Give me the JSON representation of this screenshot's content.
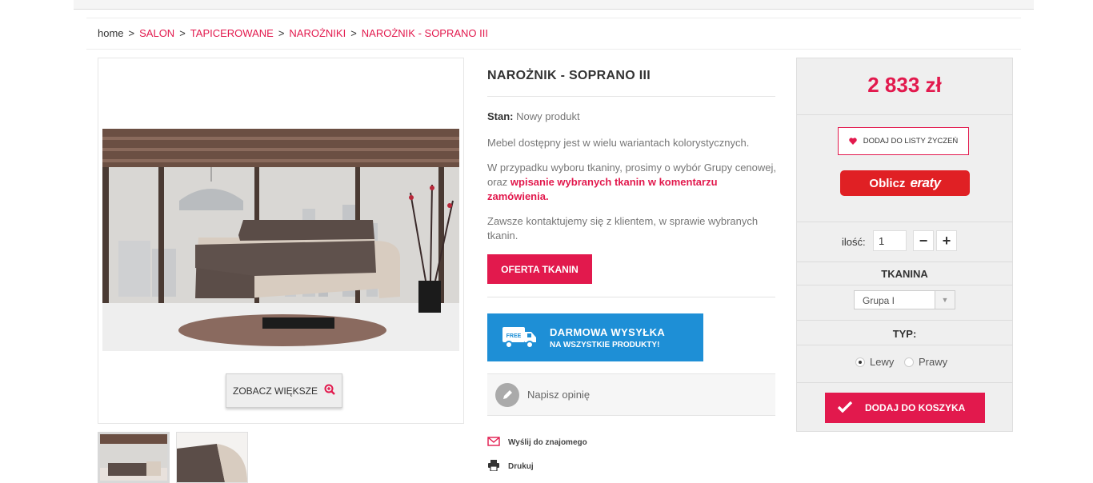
{
  "breadcrumb": {
    "home": "home",
    "separator": ">",
    "items": [
      "SALON",
      "TAPICEROWANE",
      "NAROŻNIKI",
      "NAROŻNIK - SOPRANO III"
    ]
  },
  "gallery": {
    "zoom_label": "ZOBACZ WIĘKSZE",
    "zoom_icon": "zoom-in-icon"
  },
  "product": {
    "title": "NAROŻNIK - SOPRANO III",
    "condition_label": "Stan:",
    "condition_value": "Nowy produkt",
    "desc1": "Mebel dostępny jest w wielu wariantach kolorystycznych.",
    "desc2_pre": "W przypadku wyboru tkaniny, prosimy o wybór Grupy cenowej, oraz ",
    "desc2_bold": "wpisanie wybranych tkanin w komentarzu zamówienia.",
    "desc3": "Zawsze kontaktujemy się z klientem, w sprawie wybranych tkanin.",
    "offer_button": "OFERTA TKANIN",
    "shipping_title": "DARMOWA WYSYŁKA",
    "shipping_sub": "NA WSZYSTKIE PRODUKTY!",
    "shipping_badge": "FREE",
    "review_label": "Napisz opinię",
    "send_friend": "Wyślij do znajomego",
    "print": "Drukuj"
  },
  "buy": {
    "price": "2 833 zł",
    "wishlist": "DODAJ DO LISTY ŻYCZEŃ",
    "eraty_prefix": "Oblicz",
    "eraty_brand": "eraty",
    "qty_label": "ilość:",
    "qty_value": "1",
    "minus": "−",
    "plus": "+",
    "fabric_title": "TKANINA",
    "fabric_selected": "Grupa I",
    "type_title": "TYP:",
    "type_options": [
      "Lewy",
      "Prawy"
    ],
    "type_selected": "Lewy",
    "add_to_cart": "DODAJ DO KOSZYKA"
  },
  "colors": {
    "accent": "#e2194d",
    "shipping_blue": "#1e8fd6",
    "eraty_red": "#e02024"
  }
}
